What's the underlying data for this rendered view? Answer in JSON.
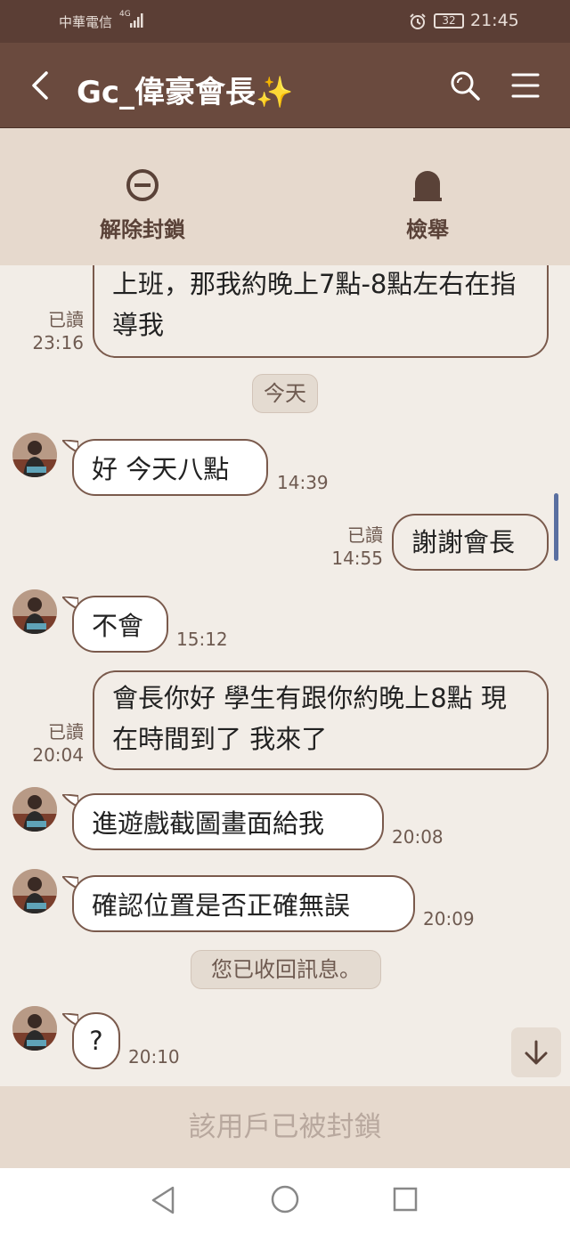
{
  "status_bar": {
    "carrier": "中華電信",
    "network": "4G",
    "battery": "32",
    "time": "21:45"
  },
  "header": {
    "title": "Gc_偉豪會長✨"
  },
  "actions": {
    "unblock": "解除封鎖",
    "report": "檢舉"
  },
  "messages": [
    {
      "dir": "out",
      "text": "上班，那我約晚上7點-8點左右在指導我",
      "read": "已讀",
      "time": "23:16"
    },
    {
      "type": "date",
      "text": "今天"
    },
    {
      "dir": "in",
      "text": "好 今天八點",
      "time": "14:39"
    },
    {
      "dir": "out",
      "text": "謝謝會長",
      "read": "已讀",
      "time": "14:55"
    },
    {
      "dir": "in",
      "text": "不會",
      "time": "15:12"
    },
    {
      "dir": "out",
      "text": "會長你好 學生有跟你約晚上8點 現在時間到了 我來了",
      "read": "已讀",
      "time": "20:04"
    },
    {
      "dir": "in",
      "text": "進遊戲截圖畫面給我",
      "time": "20:08"
    },
    {
      "dir": "in",
      "text": "確認位置是否正確無誤",
      "time": "20:09"
    },
    {
      "type": "notice",
      "text": "您已收回訊息。"
    },
    {
      "dir": "in",
      "text": "?",
      "time": "20:10"
    }
  ],
  "footer": {
    "blocked_text": "該用戶已被封鎖"
  },
  "icons": {
    "back": "back-arrow-icon",
    "search": "search-icon",
    "menu": "menu-icon",
    "unblock": "unblock-icon",
    "report": "report-icon",
    "scroll": "arrow-down-icon"
  },
  "colors": {
    "status_bar": "#5b3e35",
    "header": "#6a4a3e",
    "action_bar": "#e6d9cd",
    "chat_bg": "#f2ede7",
    "bubble_border": "#7a5a4c"
  }
}
